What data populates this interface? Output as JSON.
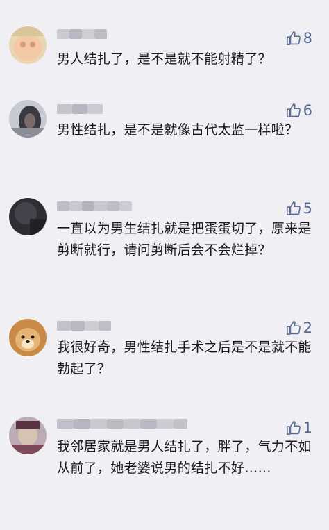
{
  "comments": [
    {
      "likes": "8",
      "text": "男人结扎了，是不是就不能射精了？",
      "avatar_colors": [
        "#f2c9a8",
        "#e8dba9",
        "#c9b78a"
      ]
    },
    {
      "likes": "6",
      "text": "男性结扎，是不是就像古代太监一样啦？",
      "avatar_colors": [
        "#cdd0d6",
        "#6b6e78",
        "#2f2f38"
      ]
    },
    {
      "likes": "5",
      "text": "一直以为男生结扎就是把蛋蛋切了，原来是剪断就行，请问剪断后会不会烂掉？",
      "avatar_colors": [
        "#3a3a42",
        "#25252b",
        "#55545c"
      ]
    },
    {
      "likes": "2",
      "text": "我很好奇，男性结扎手术之后是不是就不能勃起了？",
      "avatar_colors": [
        "#d8a55e",
        "#f3dcb0",
        "#a8672e"
      ]
    },
    {
      "likes": "1",
      "text": "我邻居家就是男人结扎了，胖了，气力不如从前了，她老婆说男的结扎不好……",
      "avatar_colors": [
        "#b9a6b0",
        "#7c4a5a",
        "#d4c2b4"
      ]
    }
  ],
  "accent_color": "#576b95",
  "icons": {
    "like": "thumbs-up-icon"
  }
}
